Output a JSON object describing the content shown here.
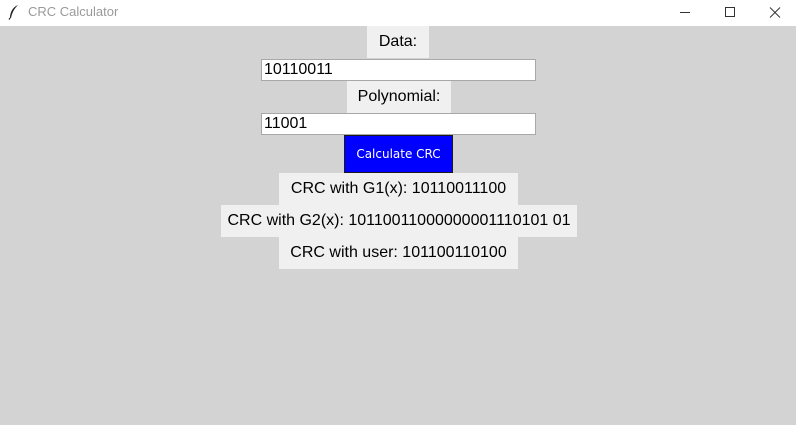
{
  "window": {
    "title": "CRC Calculator",
    "icon": "feather-icon"
  },
  "form": {
    "data_label": "Data:",
    "data_value": "10110011",
    "polynomial_label": "Polynomial:",
    "polynomial_value": "11001",
    "calculate_label": "Calculate CRC"
  },
  "results": {
    "g1": "CRC with G1(x): 10110011100",
    "g2": "CRC with G2(x): 10110011000000001110101 01",
    "user": "CRC with user: 101100110100"
  },
  "colors": {
    "button_bg": "#0000ff",
    "window_bg": "#d3d3d3",
    "label_bg": "#f0f0f0"
  }
}
